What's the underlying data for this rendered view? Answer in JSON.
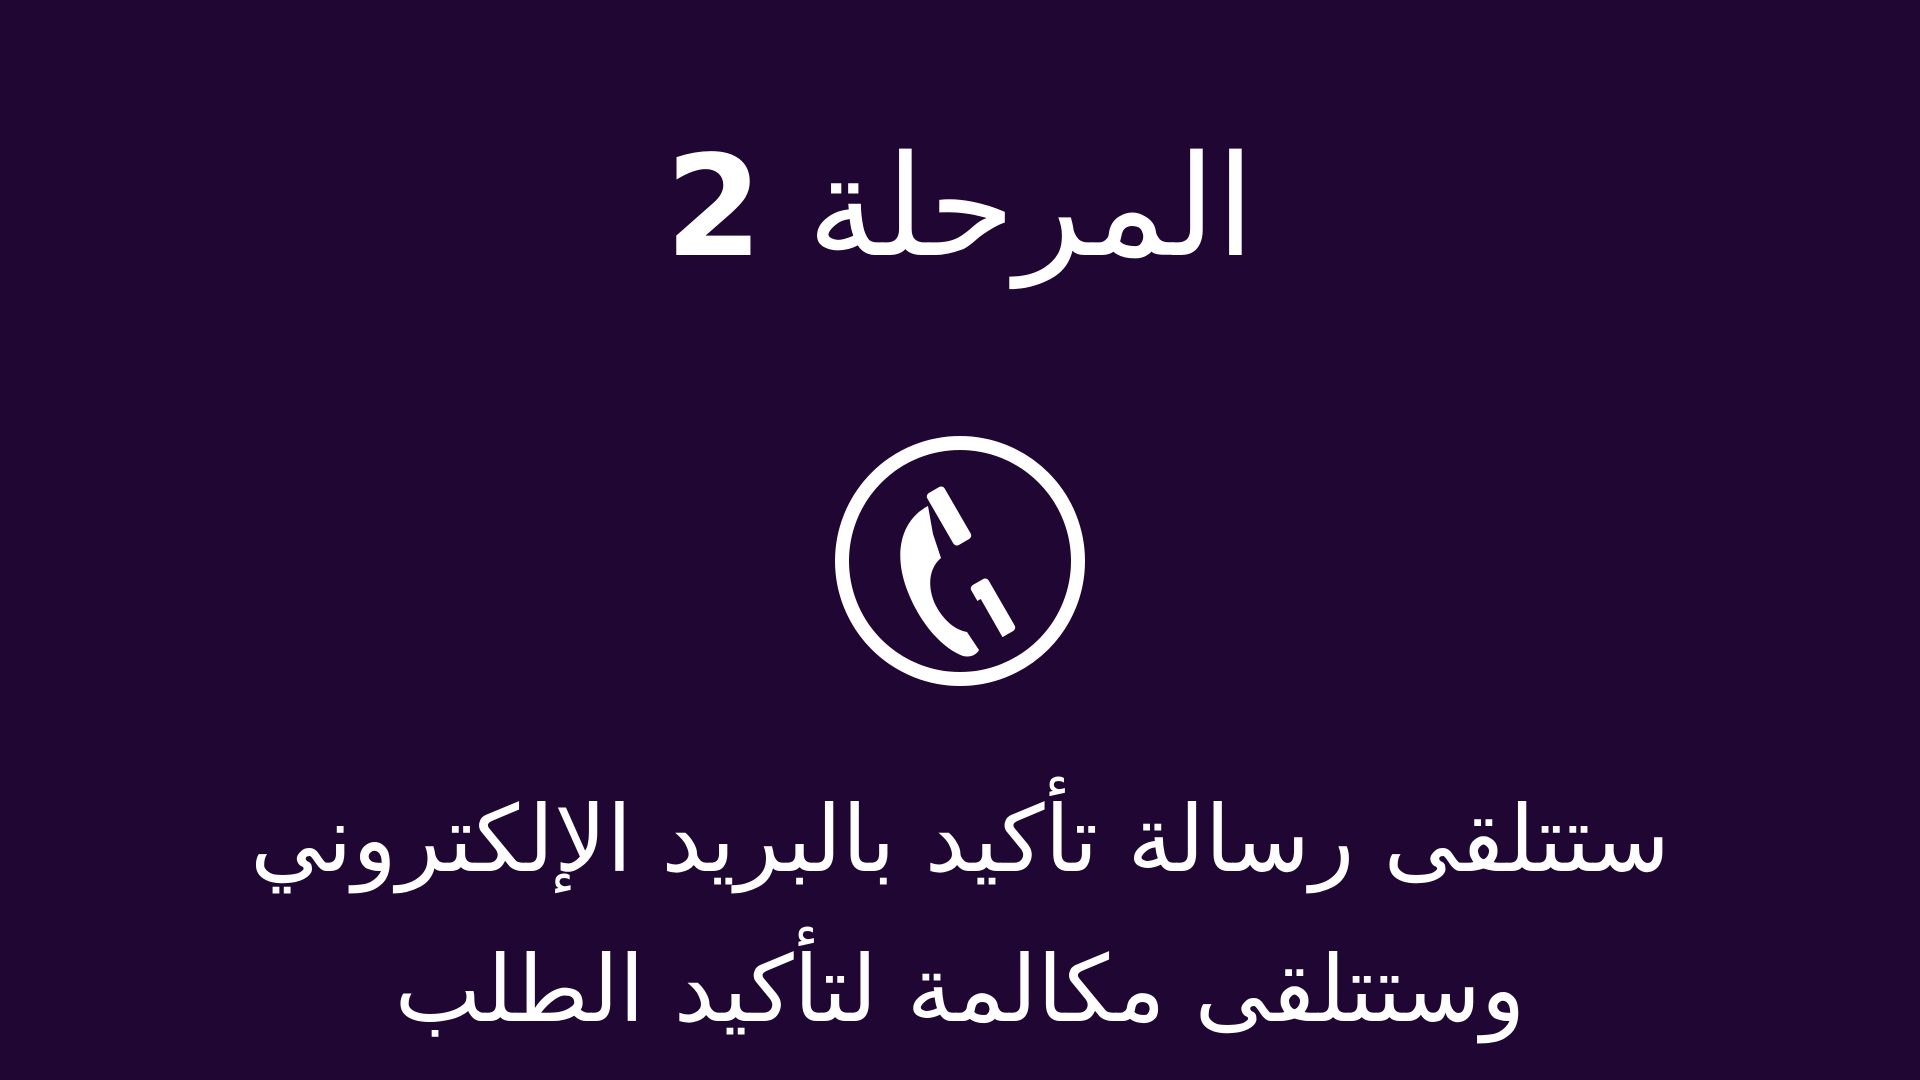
{
  "colors": {
    "background": "#1f0633",
    "foreground": "#ffffff"
  },
  "heading": {
    "text": "المرحلة",
    "number": "2"
  },
  "icon": {
    "name": "phone-handset-circle-icon"
  },
  "message": {
    "line1": "ستتلقى رسالة تأكيد بالبريد الإلكتروني",
    "line2": "وستتلقى مكالمة لتأكيد الطلب"
  }
}
